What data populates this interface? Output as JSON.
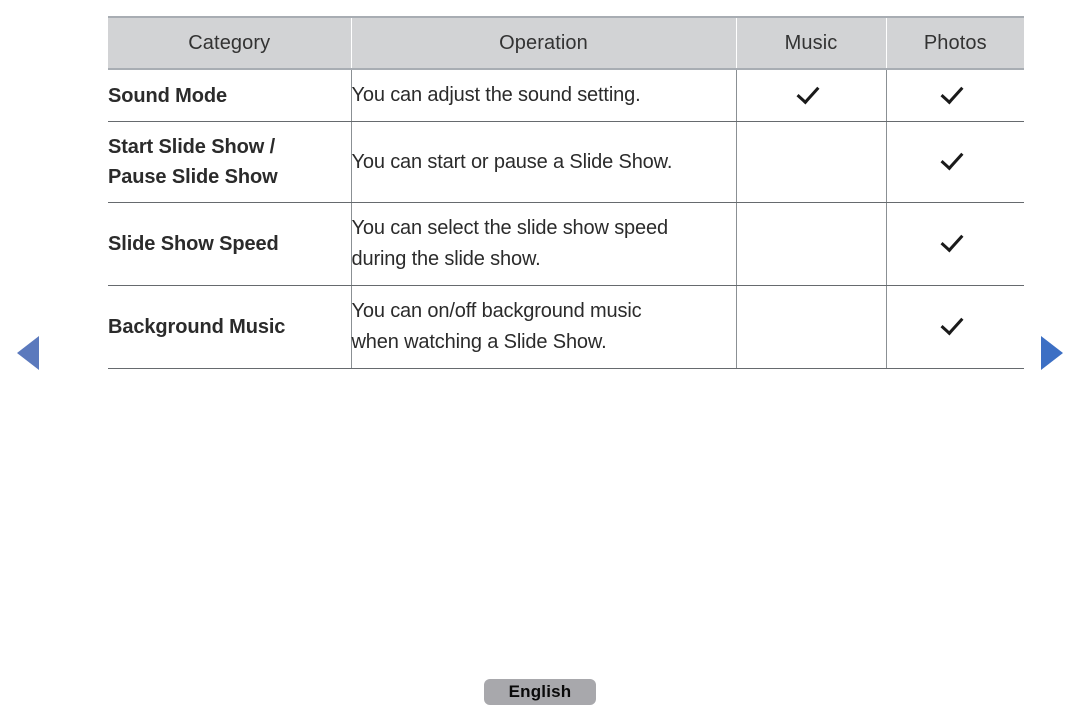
{
  "nav": {
    "prev_label": "previous-page",
    "next_label": "next-page",
    "arrow_color": "#5b79bd"
  },
  "table": {
    "headers": [
      "Category",
      "Operation",
      "Music",
      "Photos"
    ],
    "accent_color": "#5b79bd",
    "header_bg": "#d2d3d5",
    "rows": [
      {
        "category": "Sound Mode",
        "category_lines": [
          "Sound Mode"
        ],
        "operation": "You can adjust the sound setting.",
        "operation_lines": [
          "You can adjust the sound setting."
        ],
        "music": "check",
        "photos": "check"
      },
      {
        "category": "Start Slide Show / Pause Slide Show",
        "category_lines": [
          "Start Slide Show /",
          "Pause Slide Show"
        ],
        "operation": "You can start or pause a Slide Show.",
        "operation_lines": [
          "You can start or pause a Slide Show."
        ],
        "music": "",
        "photos": "check"
      },
      {
        "category": "Slide Show Speed",
        "category_lines": [
          "Slide Show Speed"
        ],
        "operation": "You can select the slide show speed during the slide show.",
        "operation_lines": [
          "You can select the slide show speed",
          "during the slide show."
        ],
        "music": "",
        "photos": "check"
      },
      {
        "category": "Background Music",
        "category_lines": [
          "Background Music"
        ],
        "operation": "You can on/off background music when watching a Slide Show.",
        "operation_lines": [
          "You can on/off background music",
          "when watching a Slide Show."
        ],
        "music": "",
        "photos": "check"
      }
    ]
  },
  "footer": {
    "language_label": "English"
  }
}
